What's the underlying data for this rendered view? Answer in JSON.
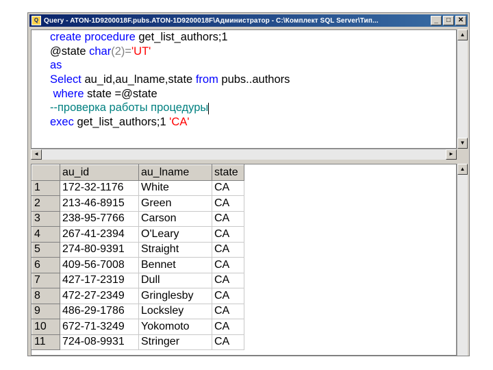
{
  "window": {
    "title": "Query - ATON-1D9200018F.pubs.ATON-1D9200018F\\Администратор - C:\\Комплект SQL Server\\Тип...",
    "app_icon_glyph": "Q",
    "minimize_glyph": "_",
    "maximize_glyph": "□",
    "close_glyph": "✕"
  },
  "editor": {
    "line1": {
      "kw": "create procedure",
      "rest": " get_list_authors;1"
    },
    "line2": {
      "var": "@state ",
      "type": "char",
      "paren": "(2)",
      "eq": "=",
      "str": "'UT'"
    },
    "line3": {
      "kw": "as"
    },
    "line4": {
      "kw1": "Select",
      "cols": " au_id,au_lname,state ",
      "kw2": "from",
      "obj": " pubs..authors"
    },
    "line5": {
      "kw": " where",
      "rest": " state =@state"
    },
    "line6": {
      "comment": "--проверка работы процедуры"
    },
    "line7": {
      "kw": "exec",
      "rest": " get_list_authors;1 ",
      "str": "'CA'"
    }
  },
  "scrollbar_glyphs": {
    "up": "▲",
    "down": "▼",
    "left": "◄",
    "right": "►"
  },
  "results": {
    "columns": [
      "au_id",
      "au_lname",
      "state"
    ],
    "rows": [
      {
        "n": "1",
        "au_id": "172-32-1176",
        "au_lname": "White",
        "state": "CA"
      },
      {
        "n": "2",
        "au_id": "213-46-8915",
        "au_lname": "Green",
        "state": "CA"
      },
      {
        "n": "3",
        "au_id": "238-95-7766",
        "au_lname": "Carson",
        "state": "CA"
      },
      {
        "n": "4",
        "au_id": "267-41-2394",
        "au_lname": "O'Leary",
        "state": "CA"
      },
      {
        "n": "5",
        "au_id": "274-80-9391",
        "au_lname": "Straight",
        "state": "CA"
      },
      {
        "n": "6",
        "au_id": "409-56-7008",
        "au_lname": "Bennet",
        "state": "CA"
      },
      {
        "n": "7",
        "au_id": "427-17-2319",
        "au_lname": "Dull",
        "state": "CA"
      },
      {
        "n": "8",
        "au_id": "472-27-2349",
        "au_lname": "Gringlesby",
        "state": "CA"
      },
      {
        "n": "9",
        "au_id": "486-29-1786",
        "au_lname": "Locksley",
        "state": "CA"
      },
      {
        "n": "10",
        "au_id": "672-71-3249",
        "au_lname": "Yokomoto",
        "state": "CA"
      },
      {
        "n": "11",
        "au_id": "724-08-9931",
        "au_lname": "Stringer",
        "state": "CA"
      }
    ]
  }
}
